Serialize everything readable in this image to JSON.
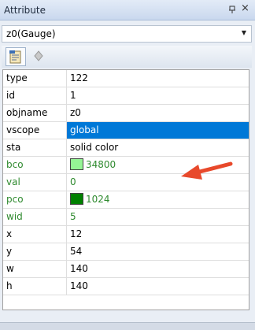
{
  "panel": {
    "title": "Attribute"
  },
  "object_selector": {
    "value": "z0(Gauge)"
  },
  "toolbar": {
    "buttons": [
      {
        "icon": "properties-icon",
        "active": true
      },
      {
        "icon": "events-icon",
        "active": false
      }
    ]
  },
  "colors": {
    "modified_text": "#2f8a2f",
    "selection": "#0078d7",
    "callout_arrow": "#e8492b"
  },
  "properties": [
    {
      "name": "type",
      "value": "122"
    },
    {
      "name": "id",
      "value": "1"
    },
    {
      "name": "objname",
      "value": "z0"
    },
    {
      "name": "vscope",
      "value": "global",
      "selected": true
    },
    {
      "name": "sta",
      "value": "solid color"
    },
    {
      "name": "bco",
      "value": "34800",
      "swatch": "#95f695",
      "modified": true
    },
    {
      "name": "val",
      "value": "0",
      "modified": true
    },
    {
      "name": "pco",
      "value": "1024",
      "swatch": "#008000",
      "modified": true
    },
    {
      "name": "wid",
      "value": "5",
      "modified": true
    },
    {
      "name": "x",
      "value": "12"
    },
    {
      "name": "y",
      "value": "54"
    },
    {
      "name": "w",
      "value": "140"
    },
    {
      "name": "h",
      "value": "140"
    }
  ]
}
